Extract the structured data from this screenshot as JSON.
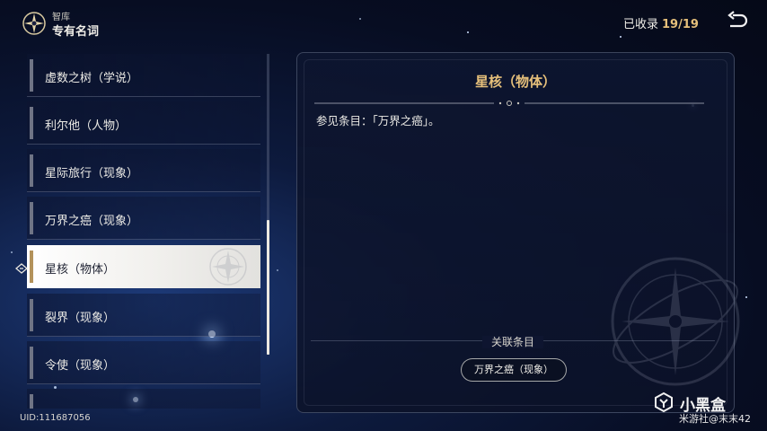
{
  "header": {
    "section": "智库",
    "title": "专有名词",
    "collected_label": "已收录",
    "collected_count": "19/19"
  },
  "list": {
    "items": [
      {
        "label": "虚数之树（学说）"
      },
      {
        "label": "利尔他（人物）"
      },
      {
        "label": "星际旅行（现象）"
      },
      {
        "label": "万界之癌（现象）"
      },
      {
        "label": "星核（物体）",
        "selected": true
      },
      {
        "label": "裂界（现象）"
      },
      {
        "label": "令使（现象）"
      }
    ]
  },
  "detail": {
    "title": "星核（物体）",
    "body": "参见条目：「万界之癌」。",
    "related_heading": "关联条目",
    "related_items": [
      {
        "label": "万界之癌（现象）"
      }
    ]
  },
  "footer": {
    "uid": "UID:111687056"
  },
  "watermark": {
    "brand": "小黑盒",
    "user": "米游社@末末42"
  },
  "colors": {
    "accent_gold": "#e6c07b",
    "selected_bar": "#b3925b",
    "background": "#0d1a3d"
  },
  "icons": {
    "logo": "compass-star-icon",
    "back": "return-arrow-icon",
    "selection": "diamond-arrow-icon"
  }
}
